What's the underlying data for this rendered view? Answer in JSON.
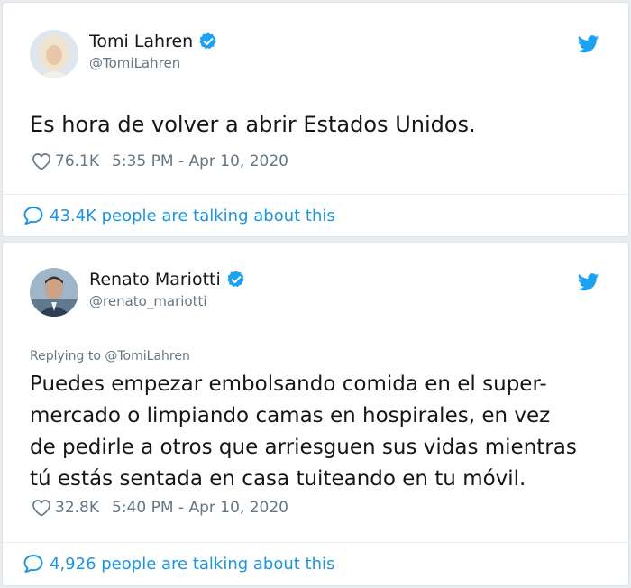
{
  "colors": {
    "link_blue": "#1b95e0",
    "verified_blue": "#1da1f2",
    "secondary_text": "#657786",
    "primary_text": "#14171a"
  },
  "tweets": [
    {
      "display_name": "Tomi Lahren",
      "handle": "@TomiLahren",
      "text": "Es hora de volver a abrir Estados Unidos.",
      "likes": "76.1K",
      "timestamp": "5:35 PM - Apr 10, 2020",
      "talking": "43.4K people are talking about this",
      "icons": {
        "verified": "verified-badge-icon",
        "platform": "twitter-bird-icon",
        "like": "heart-icon",
        "talk": "speech-bubble-icon"
      }
    },
    {
      "display_name": "Renato Mariotti",
      "handle": "@renato_mariotti",
      "replying_to": "Replying to @TomiLahren",
      "text_lines": [
        "Puedes empezar embolsando comida en el super-",
        "mercado o limpiando camas en hospirales, en vez",
        "de pedirle a otros que arriesguen sus vidas mientras",
        "tú estás sentada en casa tuiteando en tu móvil."
      ],
      "likes": "32.8K",
      "timestamp": "5:40 PM - Apr 10, 2020",
      "talking": "4,926 people are talking about this",
      "icons": {
        "verified": "verified-badge-icon",
        "platform": "twitter-bird-icon",
        "like": "heart-icon",
        "talk": "speech-bubble-icon"
      }
    }
  ]
}
